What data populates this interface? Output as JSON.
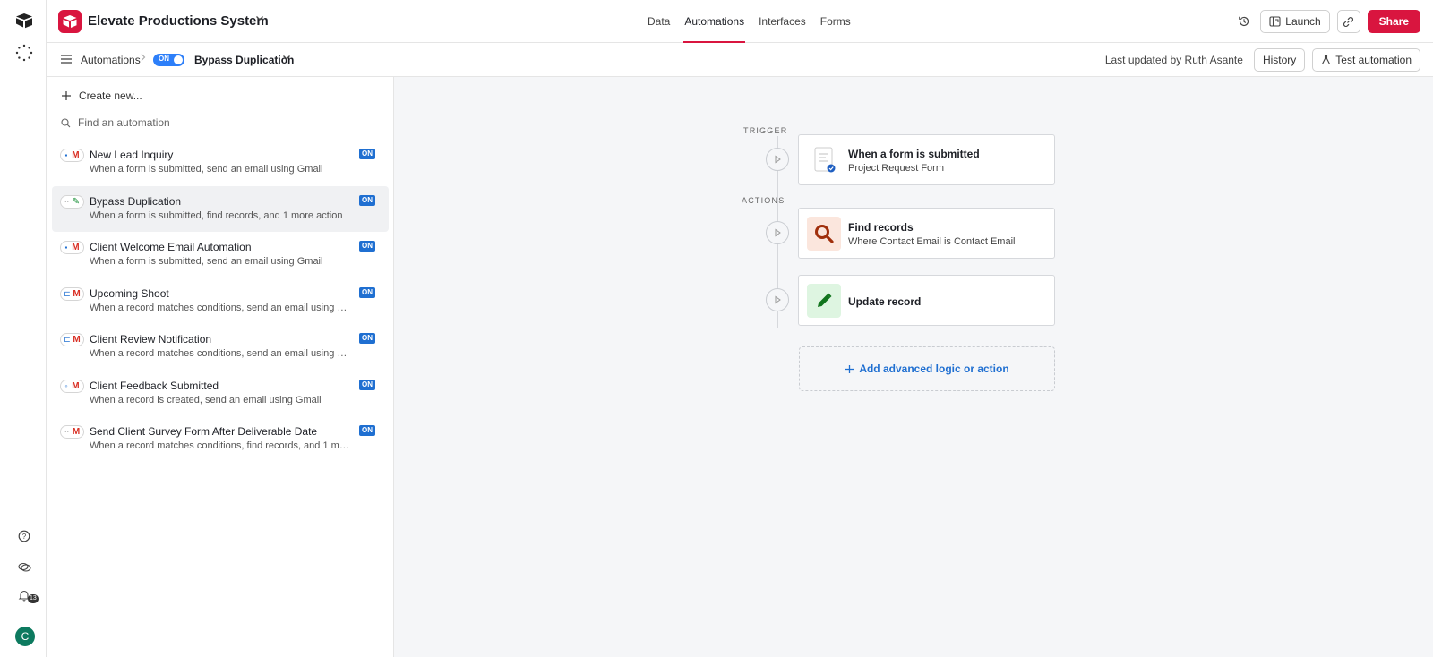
{
  "app": {
    "base_name": "Elevate Productions System",
    "tabs": [
      "Data",
      "Automations",
      "Interfaces",
      "Forms"
    ],
    "active_tab": "Automations",
    "launch_label": "Launch",
    "share_label": "Share",
    "notification_count": "13",
    "avatar_initial": "C",
    "brand_color": "#d9153f",
    "accent_color": "#2d7ff9"
  },
  "subbar": {
    "breadcrumb": "Automations",
    "toggle_label": "ON",
    "automation_name": "Bypass Duplication",
    "last_updated": "Last updated by Ruth Asante",
    "history_label": "History",
    "test_label": "Test automation"
  },
  "sidebar": {
    "create_label": "Create new...",
    "search_placeholder": "Find an automation",
    "items": [
      {
        "name": "New Lead Inquiry",
        "desc": "When a form is submitted, send an email using Gmail",
        "status": "ON",
        "icons": [
          "form-icon",
          "gmail-icon"
        ]
      },
      {
        "name": "Bypass Duplication",
        "desc": "When a form is submitted, find records, and 1 more action",
        "status": "ON",
        "icons": [
          "form-icon",
          "pencil-icon"
        ]
      },
      {
        "name": "Client Welcome Email Automation",
        "desc": "When a form is submitted, send an email using Gmail",
        "status": "ON",
        "icons": [
          "form-icon",
          "gmail-icon"
        ]
      },
      {
        "name": "Upcoming Shoot",
        "desc": "When a record matches conditions, send an email using Gm...",
        "status": "ON",
        "icons": [
          "conditions-icon",
          "gmail-icon"
        ]
      },
      {
        "name": "Client Review Notification",
        "desc": "When a record matches conditions, send an email using Gm...",
        "status": "ON",
        "icons": [
          "conditions-icon",
          "gmail-icon"
        ]
      },
      {
        "name": "Client Feedback Submitted",
        "desc": "When a record is created, send an email using Gmail",
        "status": "ON",
        "icons": [
          "record-icon",
          "gmail-icon"
        ]
      },
      {
        "name": "Send Client Survey Form After Deliverable Date",
        "desc": "When a record matches conditions, find records, and 1 more...",
        "status": "ON",
        "icons": [
          "conditions-icon",
          "gmail-icon"
        ]
      }
    ]
  },
  "canvas": {
    "trigger_label": "TRIGGER",
    "actions_label": "ACTIONS",
    "trigger": {
      "title": "When a form is submitted",
      "sub": "Project Request Form"
    },
    "actions": [
      {
        "title": "Find records",
        "sub": "Where Contact Email is Contact Email",
        "icon": "magnifier-icon"
      },
      {
        "title": "Update record",
        "sub": "",
        "icon": "pencil-icon"
      }
    ],
    "add_label": "Add advanced logic or action"
  }
}
